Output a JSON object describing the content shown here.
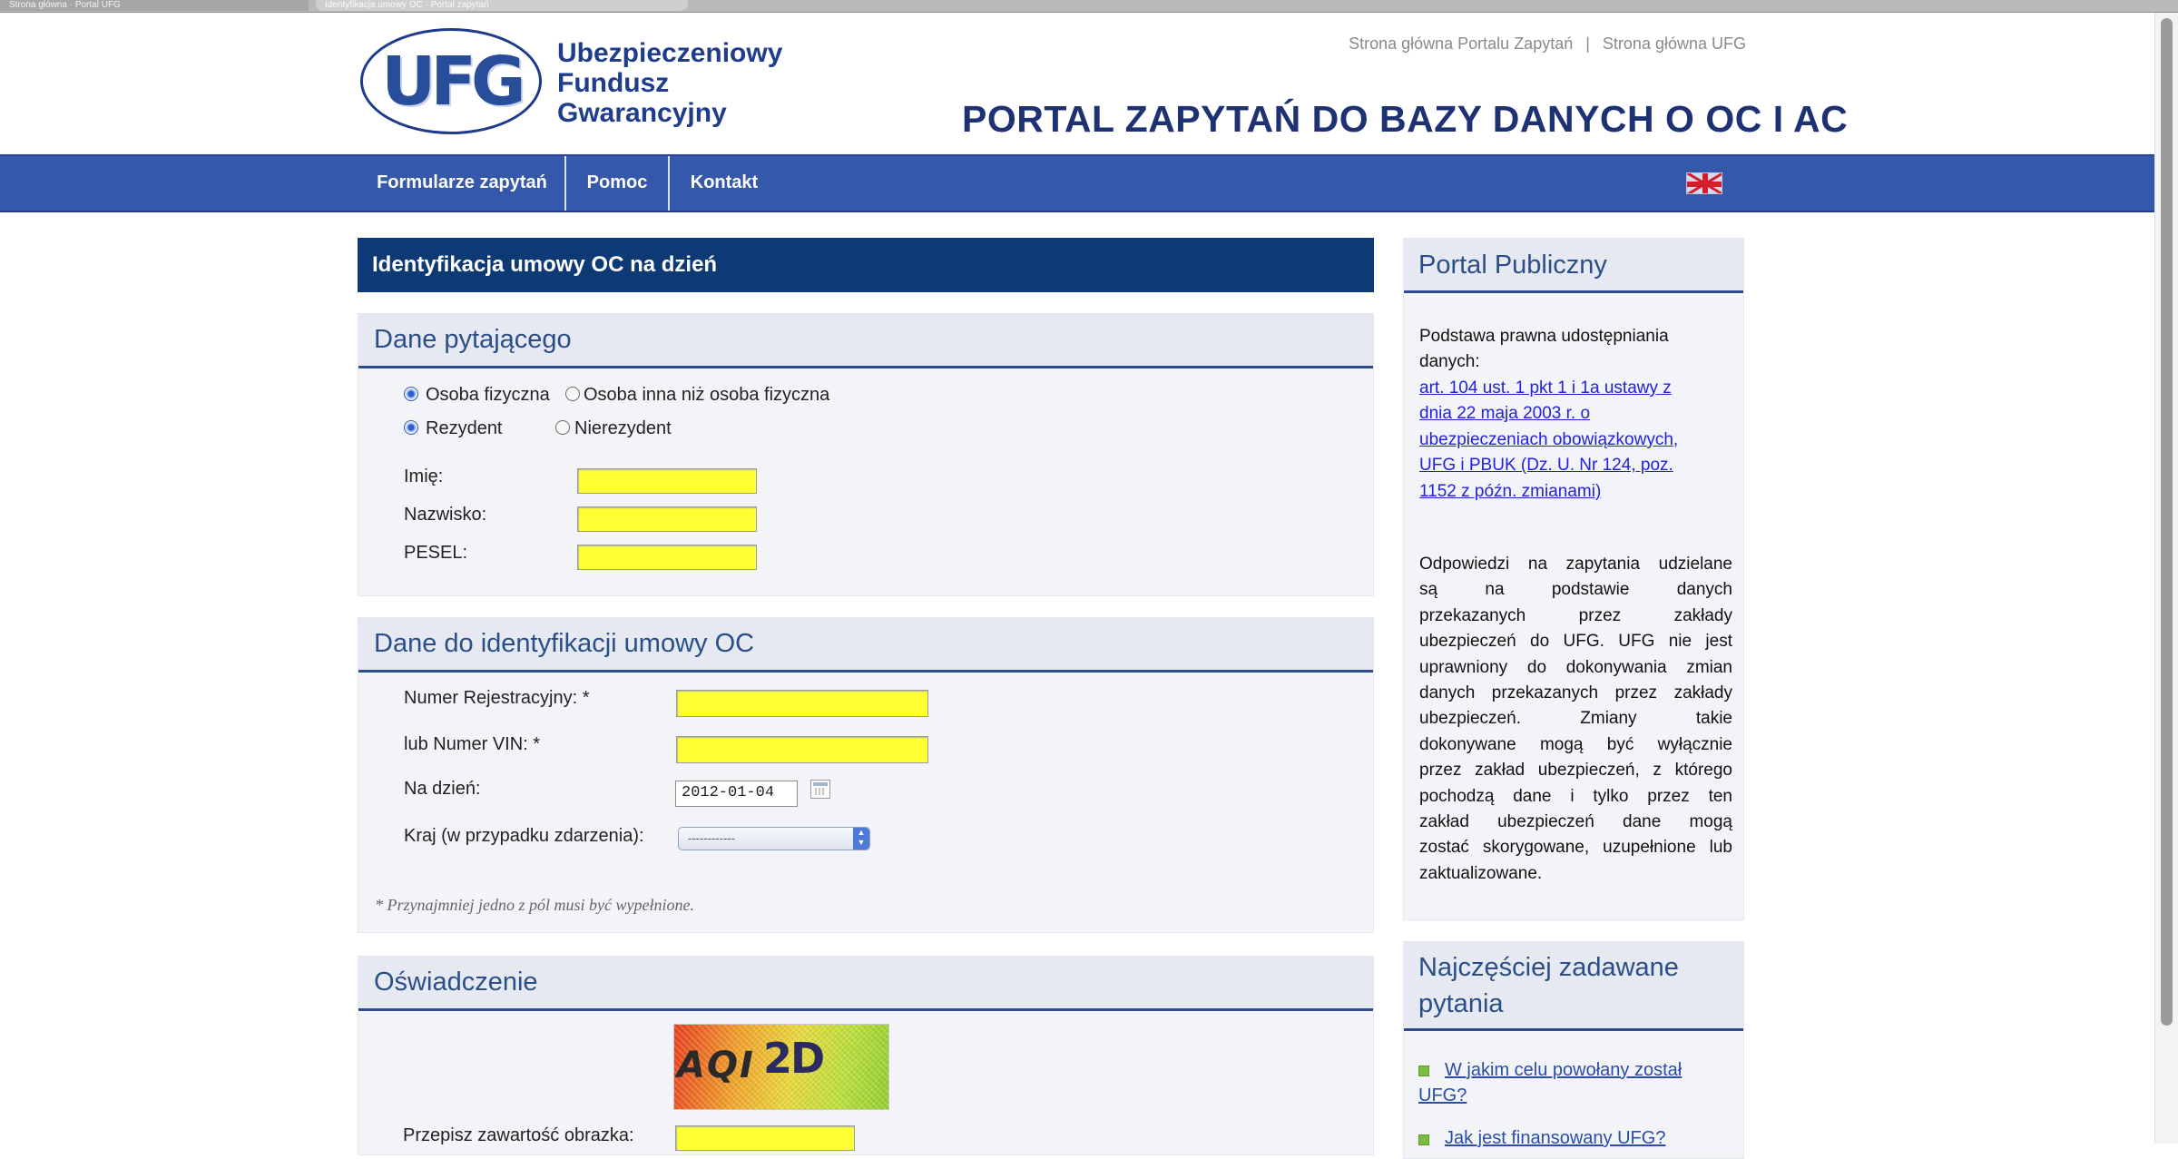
{
  "browser": {
    "tabs": [
      "Strona główna · Portal UFG",
      "Identyfikacja umowy OC · Portal zapytań"
    ]
  },
  "header": {
    "logo_text": "UFG",
    "org_name_lines": [
      "Ubezpieczeniowy",
      "Fundusz",
      "Gwarancyjny"
    ],
    "top_links": [
      "Strona główna Portalu Zapytań",
      "Strona główna UFG"
    ],
    "top_links_separator": "|",
    "portal_title": "PORTAL ZAPYTAŃ DO BAZY DANYCH O OC I AC"
  },
  "nav": {
    "items": [
      "Formularze zapytań",
      "Pomoc",
      "Kontakt"
    ],
    "language_flag": "uk-flag-icon"
  },
  "main": {
    "title": "Identyfikacja umowy OC na dzień",
    "sections": {
      "requester": {
        "heading": "Dane pytającego",
        "person_type": {
          "options": [
            "Osoba fizyczna",
            "Osoba inna niż osoba fizyczna"
          ],
          "selected": "Osoba fizyczna"
        },
        "residency": {
          "options": [
            "Rezydent",
            "Nierezydent"
          ],
          "selected": "Rezydent"
        },
        "fields": {
          "first_name": {
            "label": "Imię:",
            "value": ""
          },
          "last_name": {
            "label": "Nazwisko:",
            "value": ""
          },
          "pesel": {
            "label": "PESEL:",
            "value": ""
          }
        }
      },
      "contract": {
        "heading": "Dane do identyfikacji umowy OC",
        "fields": {
          "registration": {
            "label": "Numer Rejestracyjny: *",
            "value": ""
          },
          "vin": {
            "label": "lub Numer VIN: *",
            "value": ""
          },
          "date": {
            "label": "Na dzień:",
            "value": "2012-01-04"
          },
          "country": {
            "label": "Kraj (w przypadku zdarzenia):",
            "value": "------------"
          }
        },
        "note": "* Przynajmniej jedno z pól musi być wypełnione."
      },
      "declaration": {
        "heading": "Oświadczenie",
        "captcha_text_1": "AQI",
        "captcha_text_2": "2D",
        "captcha_label": "Przepisz zawartość obrazka:",
        "captcha_value": ""
      }
    }
  },
  "sidebar": {
    "public_portal": {
      "heading": "Portal Publiczny",
      "legal_intro_lines": [
        "Podstawa prawna udostępniania",
        "danych:"
      ],
      "legal_link_lines": [
        "art. 104 ust. 1 pkt 1 i 1a ustawy z",
        "dnia 22 maja 2003 r. o",
        "ubezpieczeniach obowiązkowych,",
        "UFG i PBUK (Dz. U. Nr 124, poz.",
        "1152 z późn. zmianami)"
      ],
      "info_lines": [
        "Odpowiedzi na zapytania udzielane",
        "są na podstawie danych",
        "przekazanych przez zakłady",
        "ubezpieczeń do UFG. UFG nie jest",
        "uprawniony do dokonywania zmian",
        "danych przekazanych przez zakłady",
        "ubezpieczeń. Zmiany takie",
        "dokonywane mogą być wyłącznie",
        "przez zakład ubezpieczeń, z którego",
        "pochodzą dane i tylko przez ten",
        "zakład ubezpieczeń dane mogą",
        "zostać skorygowane, uzupełnione lub",
        "zaktualizowane."
      ]
    },
    "faq": {
      "heading_lines": [
        "Najczęściej zadawane",
        "pytania"
      ],
      "items": [
        {
          "lines": [
            "W jakim celu powołany został",
            "UFG?"
          ]
        },
        {
          "lines": [
            "Jak jest finansowany UFG?"
          ]
        }
      ]
    }
  }
}
